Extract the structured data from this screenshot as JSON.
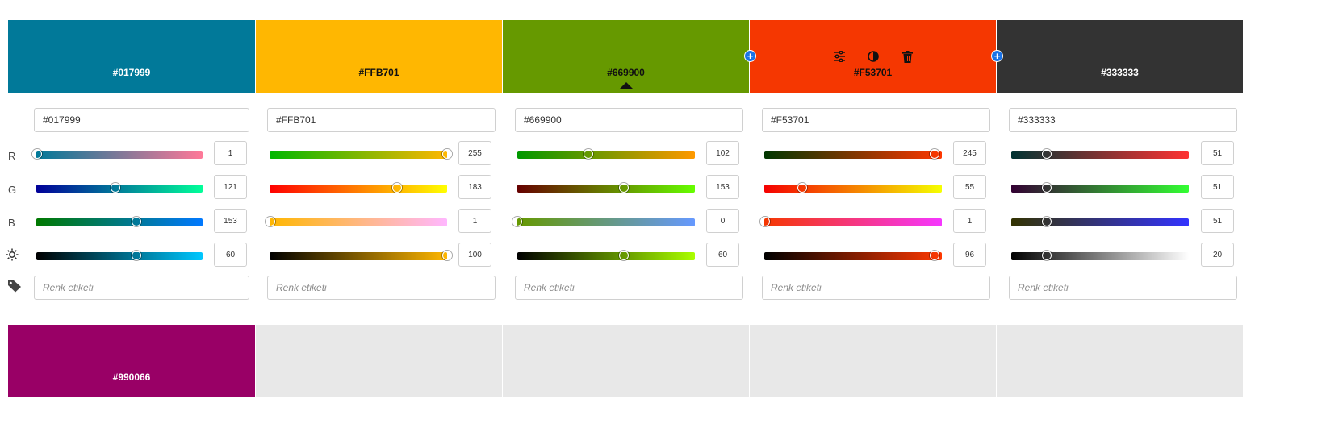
{
  "swatches": [
    {
      "hex": "#017999",
      "color": "#017999",
      "text_color": "#ffffff"
    },
    {
      "hex": "#FFB701",
      "color": "#FFB701",
      "text_color": "#111111"
    },
    {
      "hex": "#669900",
      "color": "#669900",
      "text_color": "#111111"
    },
    {
      "hex": "#F53701",
      "color": "#F53701",
      "text_color": "#111111"
    },
    {
      "hex": "#333333",
      "color": "#333333",
      "text_color": "#ffffff"
    }
  ],
  "row_labels": {
    "r": "R",
    "g": "G",
    "b": "B"
  },
  "editors": [
    {
      "hex": "#017999",
      "r": 1,
      "g": 121,
      "b": 153,
      "brightness": 60,
      "r_grad": [
        "#017999",
        "#ff7999"
      ],
      "g_grad": [
        "#010099",
        "#01ff99"
      ],
      "b_grad": [
        "#017900",
        "#0179ff"
      ],
      "br_grad": [
        "#000000",
        "#00c7ff"
      ]
    },
    {
      "hex": "#FFB701",
      "r": 255,
      "g": 183,
      "b": 1,
      "brightness": 100,
      "r_grad": [
        "#00b701",
        "#ffb701"
      ],
      "g_grad": [
        "#ff0001",
        "#ffff01"
      ],
      "b_grad": [
        "#ffb700",
        "#ffb7ff"
      ],
      "br_grad": [
        "#000000",
        "#ffb701"
      ]
    },
    {
      "hex": "#669900",
      "r": 102,
      "g": 153,
      "b": 0,
      "brightness": 60,
      "r_grad": [
        "#009900",
        "#ff9900"
      ],
      "g_grad": [
        "#660000",
        "#66ff00"
      ],
      "b_grad": [
        "#669900",
        "#6699ff"
      ],
      "br_grad": [
        "#000000",
        "#aaff00"
      ]
    },
    {
      "hex": "#F53701",
      "r": 245,
      "g": 55,
      "b": 1,
      "brightness": 96,
      "r_grad": [
        "#003701",
        "#ff3701"
      ],
      "g_grad": [
        "#f50001",
        "#f5ff01"
      ],
      "b_grad": [
        "#f53700",
        "#f537ff"
      ],
      "br_grad": [
        "#000000",
        "#ff3901"
      ]
    },
    {
      "hex": "#333333",
      "r": 51,
      "g": 51,
      "b": 51,
      "brightness": 20,
      "r_grad": [
        "#003333",
        "#ff3333"
      ],
      "g_grad": [
        "#330033",
        "#33ff33"
      ],
      "b_grad": [
        "#333300",
        "#3333ff"
      ],
      "br_grad": [
        "#000000",
        "#ffffff"
      ]
    }
  ],
  "tag_placeholder": "Renk etiketi",
  "bottom_swatch": {
    "hex": "#990066",
    "color": "#990066",
    "text_color": "#ffffff"
  },
  "empty_slot_color": "#e8e8e8",
  "icons": {
    "brightness": "sun-icon",
    "tag": "tag-icon",
    "adjust": "sliders-icon",
    "contrast": "contrast-icon",
    "delete": "trash-icon",
    "add": "plus-icon",
    "selected": "caret-up-icon"
  },
  "accent": "#1a73e8"
}
